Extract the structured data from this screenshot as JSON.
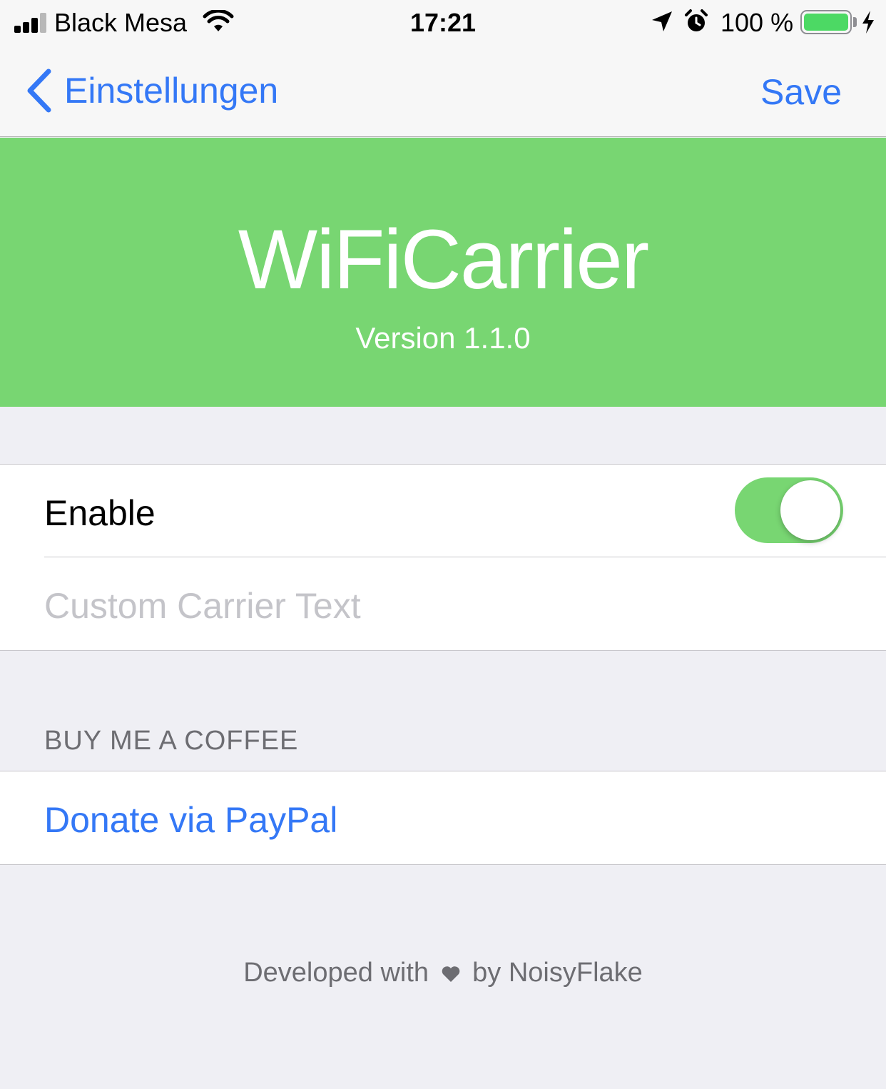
{
  "status_bar": {
    "carrier": "Black Mesa",
    "time": "17:21",
    "battery_percent": "100 %",
    "battery_level": 1.0,
    "icons": [
      "signal-icon",
      "wifi-icon",
      "location-arrow-icon",
      "alarm-icon",
      "battery-icon",
      "charging-bolt-icon"
    ]
  },
  "nav": {
    "back_label": "Einstellungen",
    "save_label": "Save"
  },
  "banner": {
    "title": "WiFiCarrier",
    "version": "Version 1.1.0",
    "background_color": "#78d672"
  },
  "settings": {
    "enable_label": "Enable",
    "enable_value": true,
    "custom_text_value": "",
    "custom_text_placeholder": "Custom Carrier Text"
  },
  "donate_section": {
    "header": "BUY ME A COFFEE",
    "link_label": "Donate via PayPal"
  },
  "footer": {
    "prefix": "Developed with",
    "suffix": "by NoisyFlake"
  },
  "colors": {
    "accent": "#3478f6",
    "toggle_on": "#78d672",
    "background": "#efeff4"
  }
}
